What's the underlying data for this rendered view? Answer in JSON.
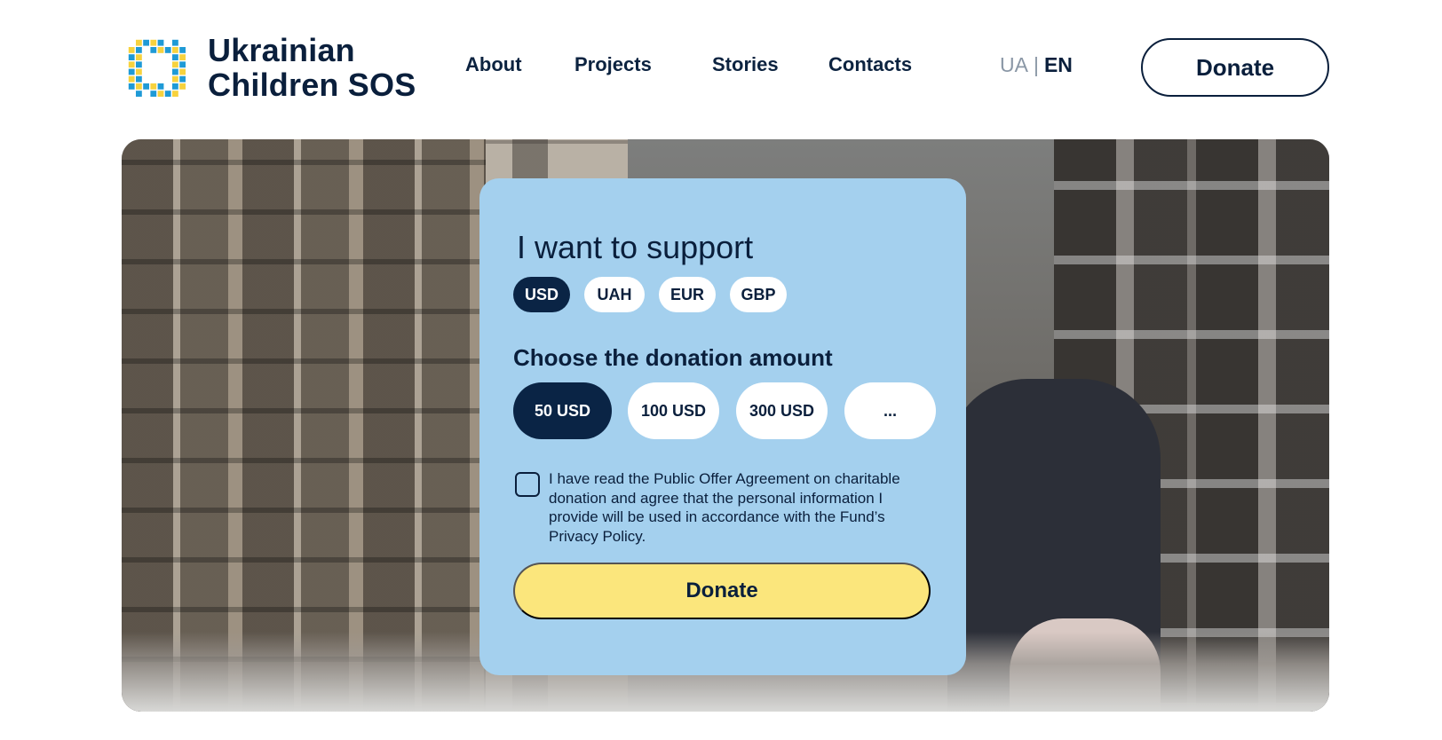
{
  "brand": {
    "line1": "Ukrainian",
    "line2": "Children SOS",
    "logo_icon": "pixel-wreath-icon",
    "colors": {
      "blue": "#1f9ad6",
      "yellow": "#f7d23e"
    }
  },
  "nav": {
    "items": [
      {
        "label": "About"
      },
      {
        "label": "Projects"
      },
      {
        "label": "Stories"
      },
      {
        "label": "Contacts"
      }
    ]
  },
  "lang": {
    "ua": "UA",
    "separator": "|",
    "en": "EN",
    "active": "EN"
  },
  "header": {
    "donate_label": "Donate"
  },
  "hero": {
    "image": "destroyed-apartment-building-photo"
  },
  "form": {
    "title": "I want to support",
    "currencies": [
      {
        "label": "USD"
      },
      {
        "label": "UAH"
      },
      {
        "label": "EUR"
      },
      {
        "label": "GBP"
      }
    ],
    "selected_currency": "USD",
    "amount_heading": "Choose the donation amount",
    "amounts": [
      {
        "label": "50 USD"
      },
      {
        "label": "100 USD"
      },
      {
        "label": "300 USD"
      },
      {
        "label": "..."
      }
    ],
    "selected_amount": "50 USD",
    "agreement_text": "I have read the Public Offer Agreement on charitable donation and agree that the personal information I provide will be used in accordance with the Fund’s Privacy Policy.",
    "agreement_checked": false,
    "donate_label": "Donate"
  },
  "colors": {
    "navy": "#0a1f3c",
    "card": "#a4d0ee",
    "donate_yellow": "#fbe67c",
    "active_pill": "#0a2445"
  }
}
